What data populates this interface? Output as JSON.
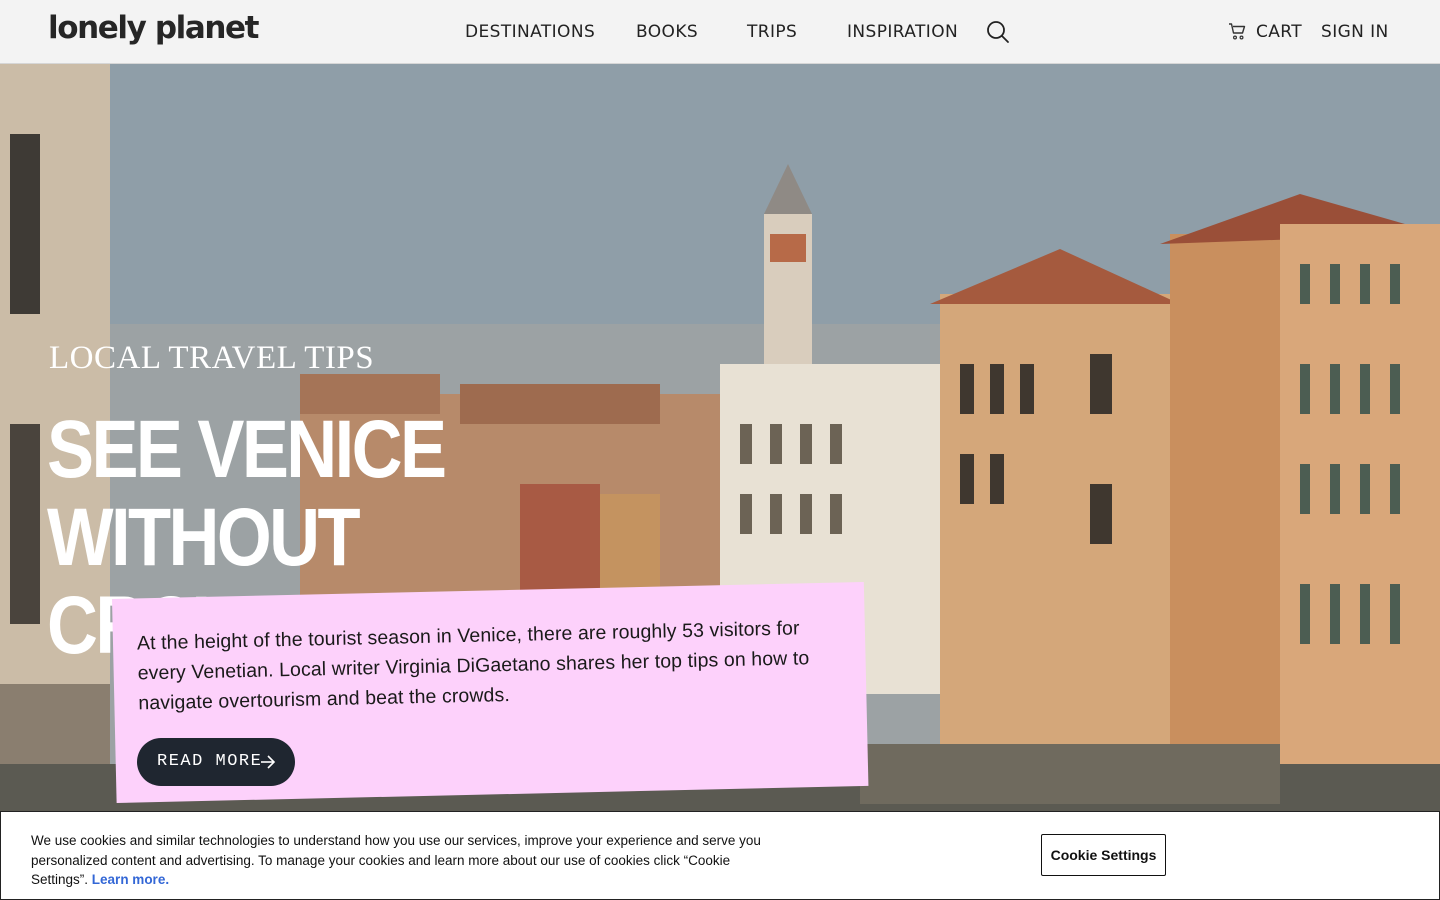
{
  "header": {
    "logo": "lonely planet",
    "nav": [
      {
        "label": "DESTINATIONS"
      },
      {
        "label": "BOOKS"
      },
      {
        "label": "TRIPS"
      },
      {
        "label": "INSPIRATION"
      }
    ],
    "search_icon": "search-icon",
    "cart_label": "CART",
    "cart_icon": "cart-icon",
    "signin_label": "SIGN IN"
  },
  "hero": {
    "eyebrow": "LOCAL TRAVEL TIPS",
    "headline": "SEE VENICE WITHOUT CROWDS",
    "description": "At the height of the tourist season in Venice, there are roughly 53 visitors for every Venetian. Local writer Virginia DiGaetano shares her top tips on how to navigate overtourism and beat the crowds.",
    "cta_label": "READ MORE",
    "cta_icon": "arrow-right-icon"
  },
  "cookie_banner": {
    "text": "We use cookies and similar technologies to understand how you use our services, improve your experience and serve you personalized content and advertising. To manage your cookies and learn more about our use of cookies click “Cookie Settings”.",
    "learn_more": "Learn more.",
    "settings_button": "Cookie Settings"
  },
  "colors": {
    "header_bg": "#f3f3f3",
    "card_bg": "#fdd1fb",
    "button_bg": "#1f2630",
    "link": "#3367d6"
  }
}
